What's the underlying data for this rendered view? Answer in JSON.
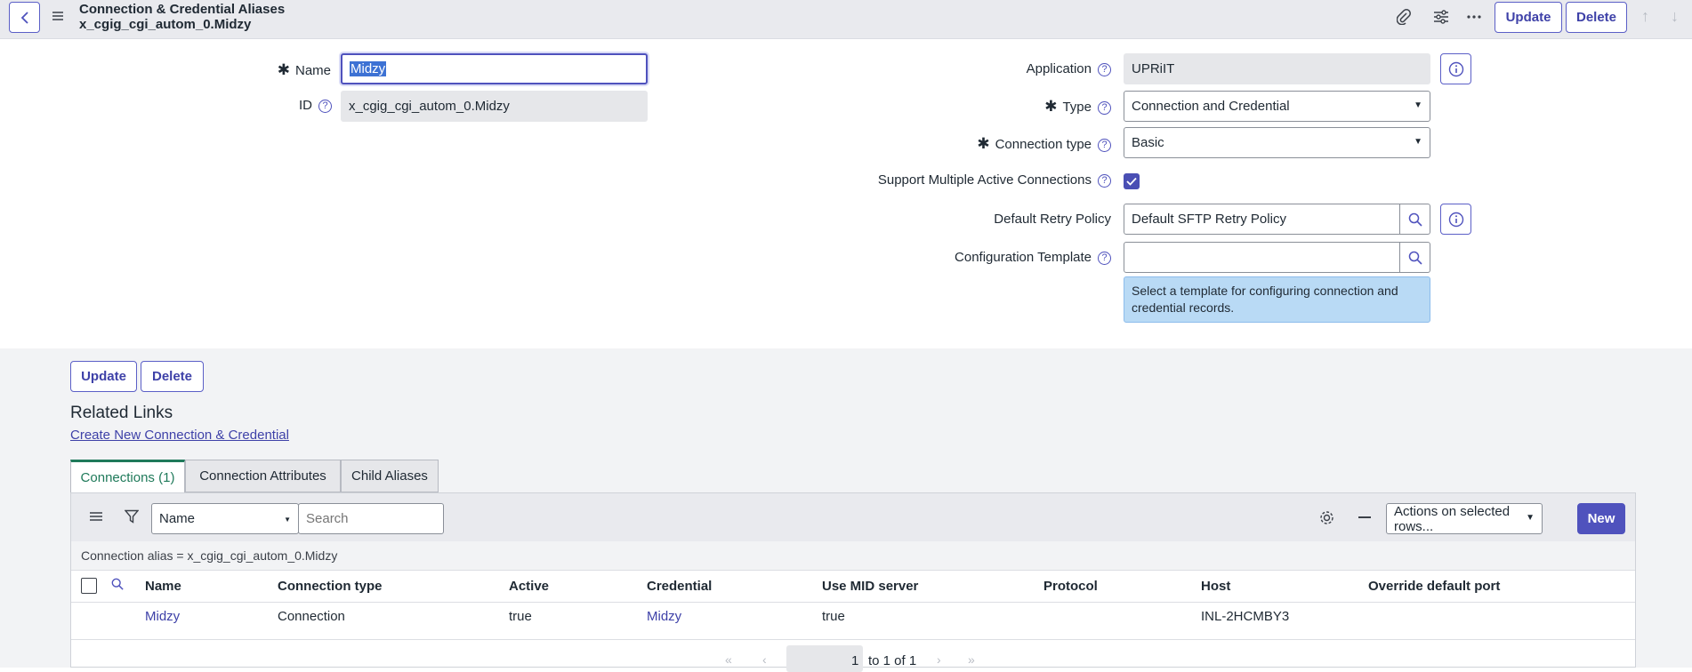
{
  "header": {
    "title": "Connection & Credential Aliases",
    "subtitle": "x_cgig_cgi_autom_0.Midzy",
    "update_label": "Update",
    "delete_label": "Delete"
  },
  "form": {
    "name_label": "Name",
    "name_value": "Midzy",
    "id_label": "ID",
    "id_value": "x_cgig_cgi_autom_0.Midzy",
    "application_label": "Application",
    "application_value": "UPRiIT",
    "type_label": "Type",
    "type_value": "Connection and Credential",
    "connection_type_label": "Connection type",
    "connection_type_value": "Basic",
    "support_multi_label": "Support Multiple Active Connections",
    "support_multi_checked": true,
    "retry_label": "Default Retry Policy",
    "retry_value": "Default SFTP Retry Policy",
    "config_label": "Configuration Template",
    "config_value": "",
    "config_hint": "Select a template for configuring connection and credential records."
  },
  "actions": {
    "update_label": "Update",
    "delete_label": "Delete"
  },
  "related": {
    "title": "Related Links",
    "create_link": "Create New Connection & Credential"
  },
  "tabs": [
    {
      "label": "Connections (1)",
      "active": true
    },
    {
      "label": "Connection Attributes",
      "active": false
    },
    {
      "label": "Child Aliases",
      "active": false
    }
  ],
  "list": {
    "search_field": "Name",
    "search_placeholder": "Search",
    "actions_select": "Actions on selected rows...",
    "new_label": "New",
    "filter": "Connection alias = x_cgig_cgi_autom_0.Midzy",
    "columns": [
      "Name",
      "Connection type",
      "Active",
      "Credential",
      "Use MID server",
      "Protocol",
      "Host",
      "Override default port"
    ],
    "rows": [
      [
        "Midzy",
        "Connection",
        "true",
        "Midzy",
        "true",
        "",
        "INL-2HCMBY3",
        ""
      ]
    ],
    "pager_current": "1",
    "pager_text": "to 1 of 1"
  }
}
